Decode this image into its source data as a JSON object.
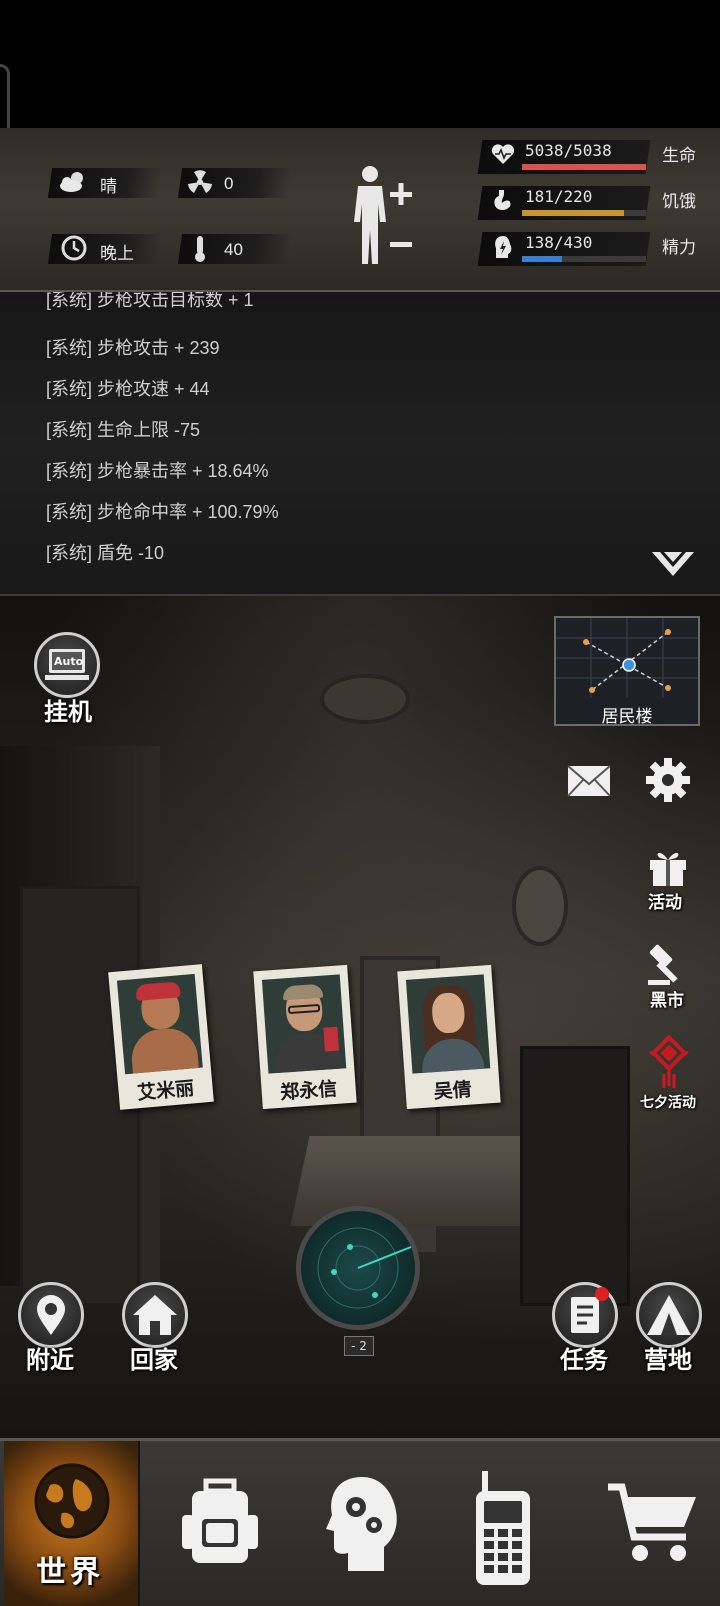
{
  "status": {
    "weather": "晴",
    "radiation": "0",
    "time_of_day": "晚上",
    "temperature": "40",
    "health": {
      "value": "5038/5038",
      "label": "生命",
      "fraction": 1.0,
      "color": "#d9534a"
    },
    "hunger": {
      "value": "181/220",
      "label": "饥饿",
      "fraction": 0.82,
      "color": "#c9962e"
    },
    "energy": {
      "value": "138/430",
      "label": "精力",
      "fraction": 0.32,
      "color": "#3b7fd1"
    }
  },
  "log": {
    "lines": [
      "[系统] 步枪攻击目标数 + 1",
      "[系统] 步枪攻击 + 239",
      "[系统] 步枪攻速 + 44",
      "[系统] 生命上限 -75",
      "[系统] 步枪暴击率 + 18.64%",
      "[系统] 步枪命中率 + 100.79%",
      "[系统] 盾免 -10"
    ]
  },
  "scene": {
    "auto_icon_text": "Auto",
    "idle_label": "挂机",
    "location_label": "居民楼",
    "events_label": "活动",
    "black_market_label": "黑市",
    "qixi_label": "七夕活动",
    "nearby_label": "附近",
    "home_label": "回家",
    "radar_level": "- 2",
    "tasks_label": "任务",
    "camp_label": "营地",
    "characters": [
      {
        "name": "艾米丽"
      },
      {
        "name": "郑永信"
      },
      {
        "name": "吴倩"
      }
    ]
  },
  "nav": {
    "world_label": "世界"
  },
  "colors": {
    "accent_orange": "#c87a1e",
    "radar_teal": "#3fd6c4",
    "notification_red": "#e02020",
    "qixi_red": "#c8191e"
  },
  "icons": [
    "cloud-sun-icon",
    "radiation-icon",
    "clock-icon",
    "thermometer-icon",
    "body-icon",
    "heart-icon",
    "stomach-icon",
    "energy-icon",
    "mail-icon",
    "gear-icon",
    "gift-icon",
    "gavel-icon",
    "chinese-knot-icon",
    "map-pin-icon",
    "home-icon",
    "task-icon",
    "tent-icon",
    "globe-icon",
    "backpack-icon",
    "head-gears-icon",
    "walkie-talkie-icon",
    "cart-icon"
  ]
}
